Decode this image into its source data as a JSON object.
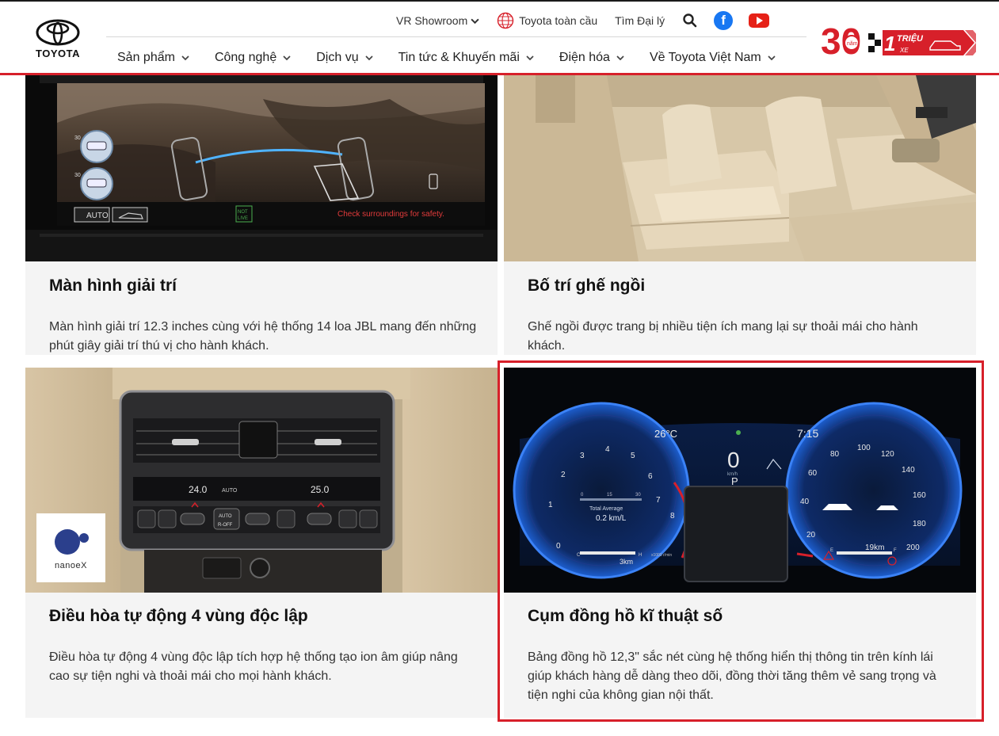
{
  "header": {
    "brand": "TOYOTA",
    "topbar": {
      "vr_showroom": "VR Showroom",
      "global": "Toyota toàn cầu",
      "dealer": "Tìm Đại lý"
    },
    "nav": [
      {
        "label": "Sản phẩm"
      },
      {
        "label": "Công nghệ"
      },
      {
        "label": "Dịch vụ"
      },
      {
        "label": "Tin tức & Khuyến mãi"
      },
      {
        "label": "Điện hóa"
      },
      {
        "label": "Về Toyota Việt Nam"
      }
    ],
    "badge": {
      "number": "30",
      "sub": "năm",
      "million": "1",
      "million_text": "TRIỆU",
      "xe": "XE"
    }
  },
  "cards": [
    {
      "title": "Màn hình giải trí",
      "desc": "Màn hình giải trí 12.3 inches cùng với hệ thống 14 loa JBL mang đến những phút giây giải trí thú vị cho hành khách.",
      "screen": {
        "auto": "AUTO",
        "not_live_1": "NOT",
        "not_live_2": "LIVE",
        "warning": "Check surroundings for safety.",
        "angle": "30"
      }
    },
    {
      "title": "Bố trí ghế ngồi",
      "desc": "Ghế ngồi được trang bị nhiều tiện ích mang lại sự thoải mái cho hành khách."
    },
    {
      "title": "Điều hòa tự động 4 vùng độc lập",
      "desc": "Điều hòa tự động 4 vùng độc lập tích hợp hệ thống tạo ion âm giúp nâng cao sự tiện nghi và thoải mái cho mọi hành khách.",
      "panel": {
        "left_temp": "24.0",
        "right_temp": "25.0",
        "auto": "AUTO",
        "auto2": "AUTO",
        "off": "R-OFF"
      },
      "nanoe_label": "nanoeX"
    },
    {
      "title": "Cụm đồng hồ kĩ thuật số",
      "desc": "Bảng đồng hồ 12,3\" sắc nét cùng hệ thống hiển thị thông tin trên kính lái giúp khách hàng dễ dàng theo dõi, đồng thời tăng thêm vẻ sang trọng và tiện nghi của không gian nội thất.",
      "cluster": {
        "temp": "26°C",
        "time": "7:15",
        "speed": "0",
        "speed_unit": "km/h",
        "gear": "P",
        "avg_label": "Total Average",
        "avg_value": "0.2 km/L",
        "range_left": "3km",
        "range_right": "19km",
        "tach_ticks": [
          "0",
          "1",
          "2",
          "3",
          "4",
          "5",
          "6",
          "7",
          "8"
        ],
        "speed_ticks": [
          "20",
          "40",
          "60",
          "80",
          "100",
          "120",
          "140",
          "160",
          "180",
          "200"
        ],
        "small_scale": [
          "0",
          "15",
          "30"
        ],
        "x1000": "x1000 r/min",
        "c_label": "C",
        "h_label": "H",
        "e_label": "E",
        "f_label": "F"
      }
    }
  ]
}
